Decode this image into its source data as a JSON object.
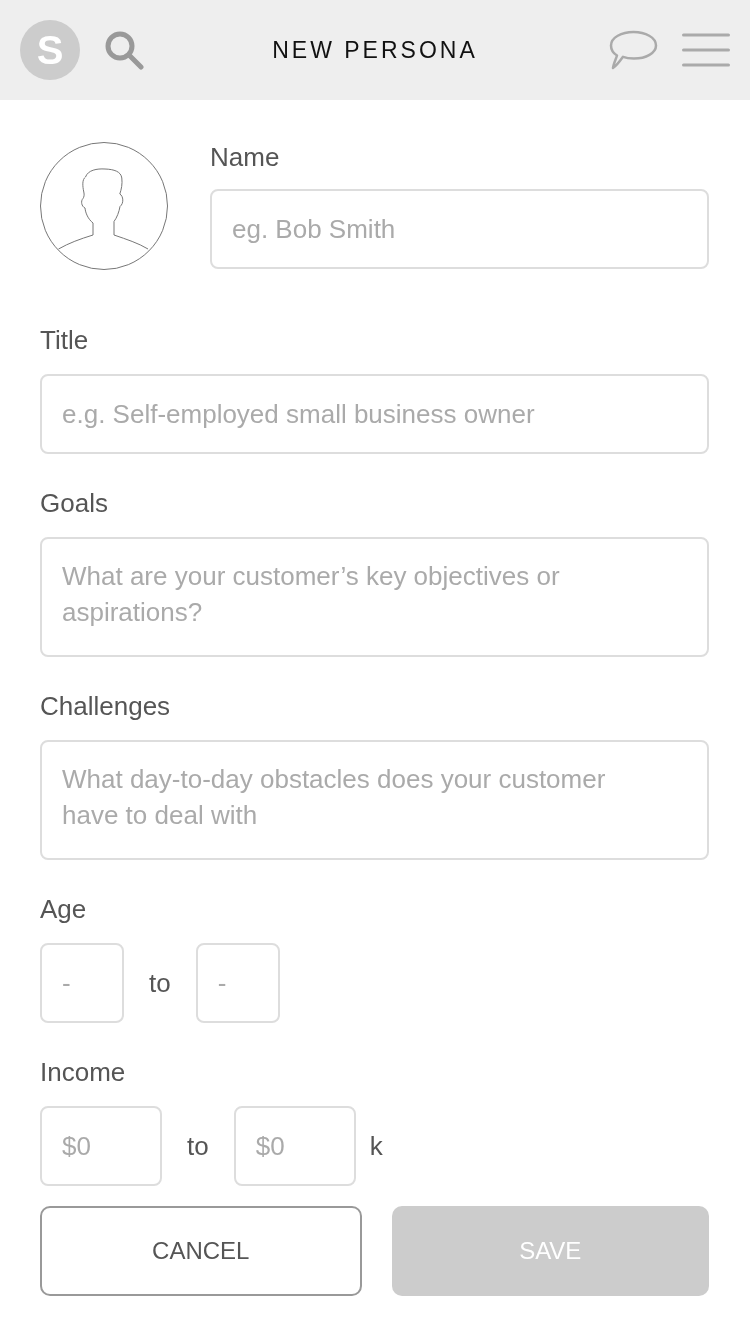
{
  "header": {
    "user_initial": "S",
    "title": "NEW PERSONA"
  },
  "profile": {
    "label": "Name",
    "placeholder": "eg. Bob Smith"
  },
  "fields": [
    {
      "kind": "text",
      "label": "Title",
      "placeholder": "e.g. Self-employed small business owner"
    },
    {
      "kind": "textarea",
      "label": "Goals",
      "placeholder": "What are your customer’s key objectives or aspirations?"
    },
    {
      "kind": "textarea",
      "label": "Challenges",
      "placeholder": "What day-to-day obstacles does your customer have to deal with"
    },
    {
      "kind": "numrange",
      "label": "Age",
      "from_placeholder": "-",
      "separator": "to",
      "to_placeholder": "-"
    },
    {
      "kind": "moneyrange",
      "label": "Income",
      "from_placeholder": "$0",
      "separator": "to",
      "to_placeholder": "$0",
      "unit": "k"
    }
  ],
  "buttons": [
    {
      "kind": "outline",
      "label": "CANCEL",
      "disabled": false
    },
    {
      "kind": "filled",
      "label": "SAVE",
      "disabled": true
    }
  ]
}
